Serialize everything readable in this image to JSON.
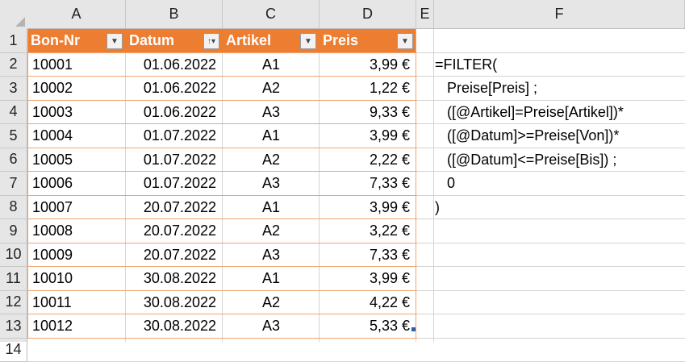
{
  "column_headers": [
    "A",
    "B",
    "C",
    "D",
    "E",
    "F"
  ],
  "row_headers": [
    "1",
    "2",
    "3",
    "4",
    "5",
    "6",
    "7",
    "8",
    "9",
    "10",
    "11",
    "12",
    "13",
    "14"
  ],
  "table": {
    "headers": [
      "Bon-Nr",
      "Datum",
      "Artikel",
      "Preis"
    ],
    "rows": [
      [
        "10001",
        "01.06.2022",
        "A1",
        "3,99 €"
      ],
      [
        "10002",
        "01.06.2022",
        "A2",
        "1,22 €"
      ],
      [
        "10003",
        "01.06.2022",
        "A3",
        "9,33 €"
      ],
      [
        "10004",
        "01.07.2022",
        "A1",
        "3,99 €"
      ],
      [
        "10005",
        "01.07.2022",
        "A2",
        "2,22 €"
      ],
      [
        "10006",
        "01.07.2022",
        "A3",
        "7,33 €"
      ],
      [
        "10007",
        "20.07.2022",
        "A1",
        "3,99 €"
      ],
      [
        "10008",
        "20.07.2022",
        "A2",
        "3,22 €"
      ],
      [
        "10009",
        "20.07.2022",
        "A3",
        "7,33 €"
      ],
      [
        "10010",
        "30.08.2022",
        "A1",
        "3,99 €"
      ],
      [
        "10011",
        "30.08.2022",
        "A2",
        "4,22 €"
      ],
      [
        "10012",
        "30.08.2022",
        "A3",
        "5,33 €"
      ]
    ]
  },
  "formula_lines": [
    "=FILTER(",
    "   Preise[Preis] ;",
    "   ([@Artikel]=Preise[Artikel])*",
    "   ([@Datum]>=Preise[Von])*",
    "   ([@Datum]<=Preise[Bis]) ;",
    "   0",
    ")"
  ],
  "colors": {
    "table_header": "#ed7d31",
    "table_border": "#f0a571",
    "header_selected_text": "#106b32"
  }
}
